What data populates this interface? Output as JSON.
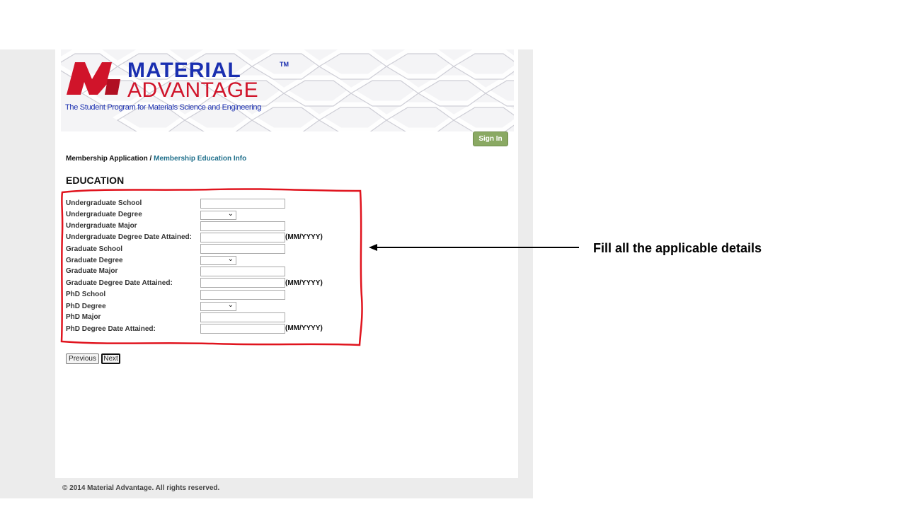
{
  "logo": {
    "word1": "MATERIAL",
    "trademark": "TM",
    "word2": "ADVANTAGE",
    "tagline": "The Student Program for Materials Science and Engineering"
  },
  "header": {
    "signin_label": "Sign In"
  },
  "breadcrumb": {
    "parent": "Membership Application",
    "separator": " / ",
    "current": "Membership Education Info"
  },
  "section": {
    "title": "EDUCATION"
  },
  "form": {
    "date_hint": "(MM/YYYY)",
    "fields": [
      {
        "label": "Undergraduate School",
        "type": "text",
        "value": ""
      },
      {
        "label": "Undergraduate Degree",
        "type": "select",
        "value": ""
      },
      {
        "label": "Undergraduate Major",
        "type": "text",
        "value": ""
      },
      {
        "label": "Undergraduate Degree Date Attained:",
        "type": "date",
        "value": ""
      },
      {
        "label": "Graduate School",
        "type": "text",
        "value": ""
      },
      {
        "label": "Graduate Degree",
        "type": "select",
        "value": ""
      },
      {
        "label": "Graduate Major",
        "type": "text",
        "value": ""
      },
      {
        "label": "Graduate Degree Date Attained:",
        "type": "date",
        "value": ""
      },
      {
        "label": "PhD School",
        "type": "text",
        "value": ""
      },
      {
        "label": "PhD Degree",
        "type": "select",
        "value": ""
      },
      {
        "label": "PhD Major",
        "type": "text",
        "value": ""
      },
      {
        "label": "PhD Degree Date Attained:",
        "type": "date",
        "value": ""
      }
    ]
  },
  "nav_buttons": {
    "previous": "Previous",
    "next": "Next"
  },
  "footer": {
    "copyright": "© 2014 Material Advantage. All rights reserved."
  },
  "annotation": {
    "text": "Fill all the applicable details",
    "highlight_color": "#e0141e"
  },
  "colors": {
    "brand_blue": "#1a2fb0",
    "brand_red": "#d0142a",
    "signin_green": "#8aa963",
    "breadcrumb_link": "#1f6f8b"
  }
}
